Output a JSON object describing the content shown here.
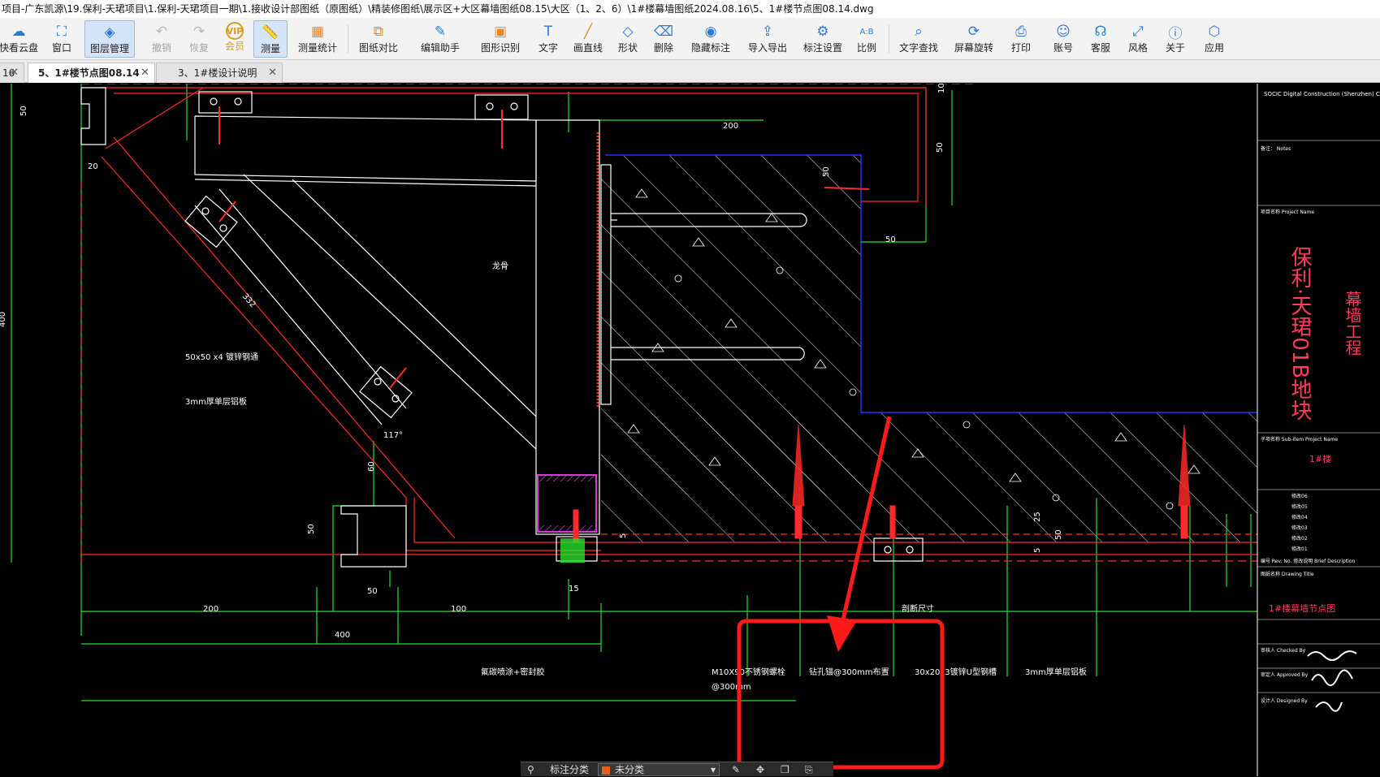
{
  "title_bar": {
    "text": "项目-广东凯源\\19.保利-天珺项目\\1.保利-天珺项目一期\\1.接收设计部图纸（原图纸）\\精装修图纸\\展示区+大区幕墙图纸08.15\\大区（1、2、6）\\1#楼幕墙图纸2024.08.16\\5、1#楼节点图08.14.dwg"
  },
  "toolbar": {
    "cloud": "快看云盘",
    "window": "窗口",
    "layers": "图层管理",
    "undo": "撤销",
    "redo": "恢复",
    "vip": "会员",
    "vip_badge": "VIP",
    "measure": "测量",
    "measure_stats": "测量统计",
    "compare": "图纸对比",
    "edit_assistant": "编辑助手",
    "shape_recog": "图形识别",
    "text": "文字",
    "line": "画直线",
    "shape": "形状",
    "delete": "删除",
    "hide_annot": "隐藏标注",
    "import_export": "导入导出",
    "annot_settings": "标注设置",
    "scale": "比例",
    "text_search": "文字查找",
    "screen_rotate": "屏幕旋转",
    "print": "打印",
    "account": "账号",
    "support": "客服",
    "style": "风格",
    "about": "关于",
    "apps": "应用"
  },
  "tabs": [
    {
      "label": "16",
      "close": "✕"
    },
    {
      "label": "5、1#楼节点图08.14",
      "close": "✕"
    },
    {
      "label": "3、1#楼设计说明",
      "close": "✕"
    }
  ],
  "drawing": {
    "dim_200": "200",
    "dim_50": "50",
    "dim_20": "20",
    "dim_400": "400",
    "dim_100": "100",
    "dim_332": "332",
    "dim_60": "60",
    "dim_10": "10",
    "dim_15": "15",
    "dim_5": "5",
    "dim_25": "25",
    "note_steel": "50x50 x4 镀锌钢通",
    "note_plate": "3mm厚单层铝板",
    "note_keel": "龙骨",
    "note_paint": "氟碳喷涂+密封胶",
    "note_bolt": "M10X90不锈钢螺栓",
    "note_bolt_spacing": "@300mm",
    "note_anchor": "钻孔锚@300mm布置",
    "note_channel": "30x20x3镀锌U型钢槽",
    "note_plate2": "3mm厚单层铝板",
    "note_cut": "剖断尺寸",
    "angle": "117°"
  },
  "title_block": {
    "company_en": "SOCIC Digital Construction (Shenzhen) Co., LTD",
    "notes_label": "备注： Notes",
    "project_label": "项目名称 Project Name",
    "project_name": "保利·天珺01B地块",
    "project_sub": "幕墙工程",
    "subitem_label": "子项名称 Sub-item Project Name",
    "subitem": "1#楼",
    "revisions": [
      "修改06",
      "修改05",
      "修改04",
      "修改03",
      "修改02",
      "修改01"
    ],
    "rev_cols": "编号 Rev. No.   修改说明 Brief Description",
    "drawing_title_label": "图纸名称 Drawing Title",
    "drawing_title": "1#楼幕墙节点图",
    "designer_label": "审核人 Checked By",
    "approver_label": "审定人 Approved By",
    "drawer_label": "设计人 Designed By"
  },
  "annotation_bar": {
    "label": "标注分类",
    "selected": "未分类"
  },
  "colors": {
    "green": "#27e02a",
    "red": "#ff2a2a",
    "white": "#ffffff",
    "blue": "#2233ff",
    "magenta": "#d63bd6",
    "highlight": "#ff1a1a"
  }
}
